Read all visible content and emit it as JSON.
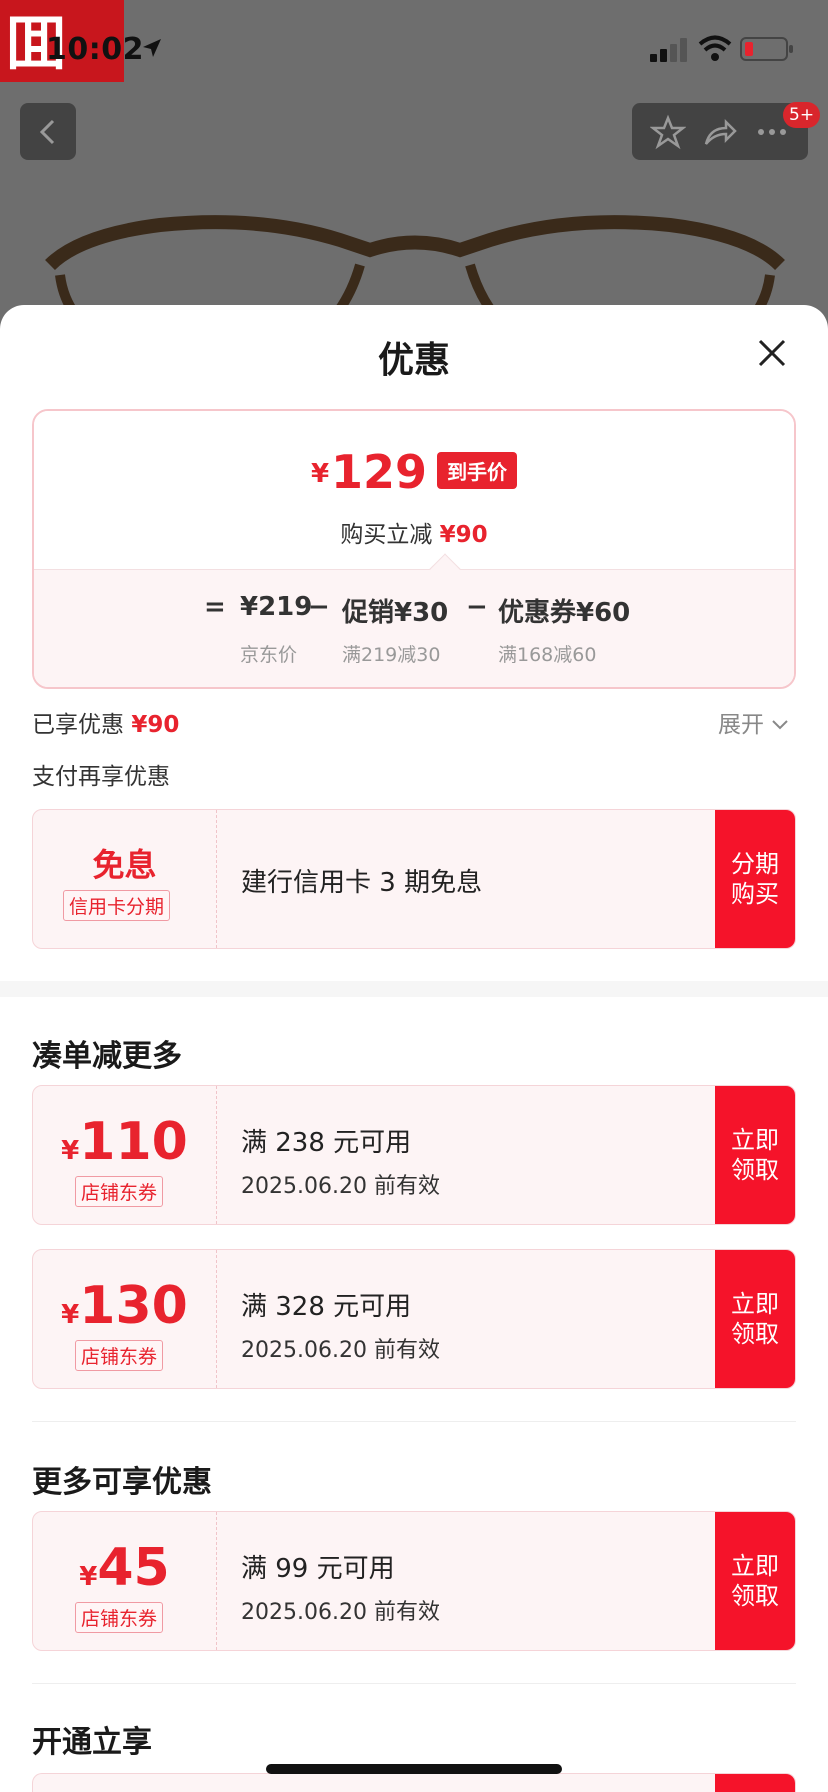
{
  "status_bar": {
    "time": "10:02"
  },
  "header": {
    "badge": "5+"
  },
  "sheet": {
    "title": "优惠",
    "final_price": {
      "currency": "¥",
      "amount": "129",
      "tag": "到手价"
    },
    "instant_save": {
      "label": "购买立减",
      "value": "¥90"
    },
    "breakdown": {
      "equals": "=",
      "minus": "−",
      "jd_price": "¥219",
      "jd_label": "京东价",
      "promo": "促销¥30",
      "promo_cond": "满219减30",
      "coupon": "优惠券¥60",
      "coupon_cond": "满168减60"
    },
    "enjoyed": {
      "label": "已享优惠",
      "value": "¥90",
      "expand": "展开"
    },
    "pay_more": "支付再享优惠",
    "installment": {
      "title": "免息",
      "tag": "信用卡分期",
      "desc": "建行信用卡 3 期免息",
      "action_l1": "分期",
      "action_l2": "购买"
    },
    "section_more": {
      "title": "凑单减更多",
      "coupons": [
        {
          "currency": "¥",
          "amount": "110",
          "tag": "店铺东券",
          "condition": "满 238 元可用",
          "expiry": "2025.06.20 前有效",
          "action_l1": "立即",
          "action_l2": "领取"
        },
        {
          "currency": "¥",
          "amount": "130",
          "tag": "店铺东券",
          "condition": "满 328 元可用",
          "expiry": "2025.06.20 前有效",
          "action_l1": "立即",
          "action_l2": "领取"
        }
      ]
    },
    "section_extra": {
      "title": "更多可享优惠",
      "coupons": [
        {
          "currency": "¥",
          "amount": "45",
          "tag": "店铺东券",
          "condition": "满 99 元可用",
          "expiry": "2025.06.20 前有效",
          "action_l1": "立即",
          "action_l2": "领取"
        }
      ]
    },
    "section_open": {
      "title": "开通立享"
    }
  }
}
